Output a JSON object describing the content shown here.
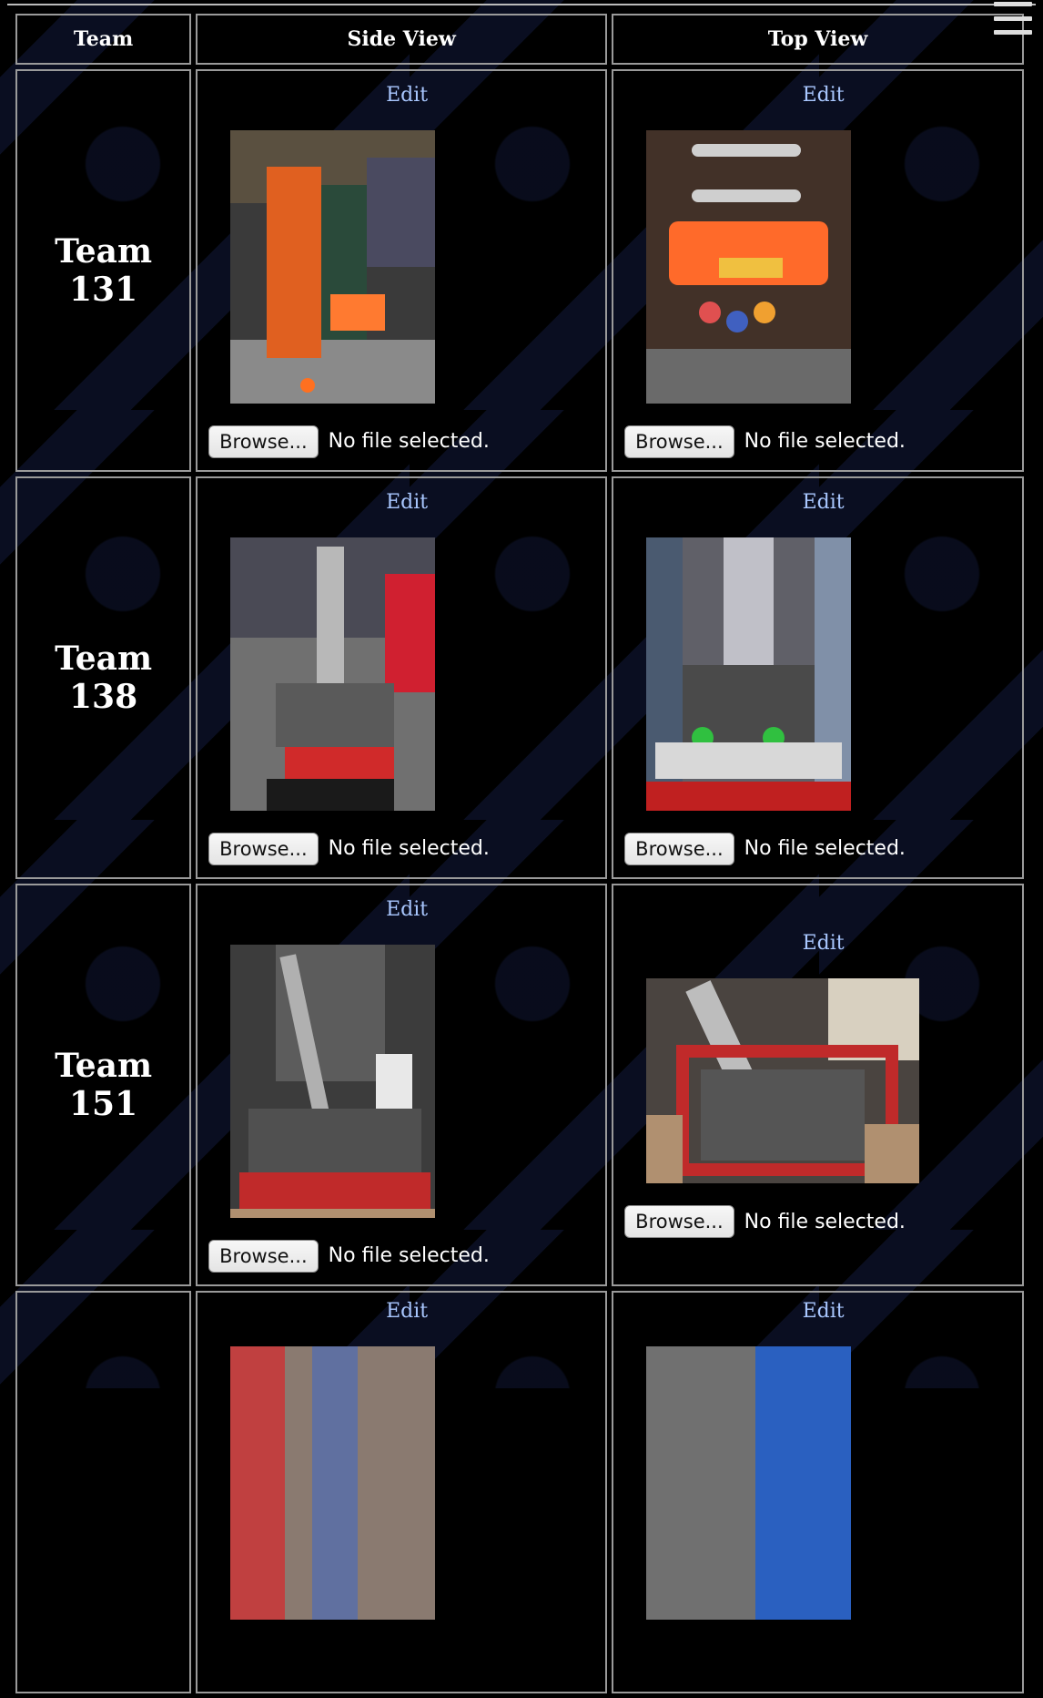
{
  "header": {
    "team": "Team",
    "side_view": "Side View",
    "top_view": "Top View"
  },
  "icons": {
    "menu": "hamburger-menu-icon"
  },
  "rows": [
    {
      "team": "Team 131",
      "side": {
        "edit": "Edit",
        "browse": "Browse...",
        "status": "No file selected."
      },
      "top": {
        "edit": "Edit",
        "browse": "Browse...",
        "status": "No file selected."
      }
    },
    {
      "team": "Team 138",
      "side": {
        "edit": "Edit",
        "browse": "Browse...",
        "status": "No file selected."
      },
      "top": {
        "edit": "Edit",
        "browse": "Browse...",
        "status": "No file selected."
      }
    },
    {
      "team": "Team 151",
      "side": {
        "edit": "Edit",
        "browse": "Browse...",
        "status": "No file selected."
      },
      "top": {
        "edit": "Edit",
        "browse": "Browse...",
        "status": "No file selected."
      }
    },
    {
      "team": "",
      "side": {
        "edit": "Edit"
      },
      "top": {
        "edit": "Edit"
      }
    }
  ],
  "colors": {
    "background": "#000000",
    "link": "#a9c7ff",
    "border": "#9a9a9a",
    "pattern": "#121a3c"
  }
}
